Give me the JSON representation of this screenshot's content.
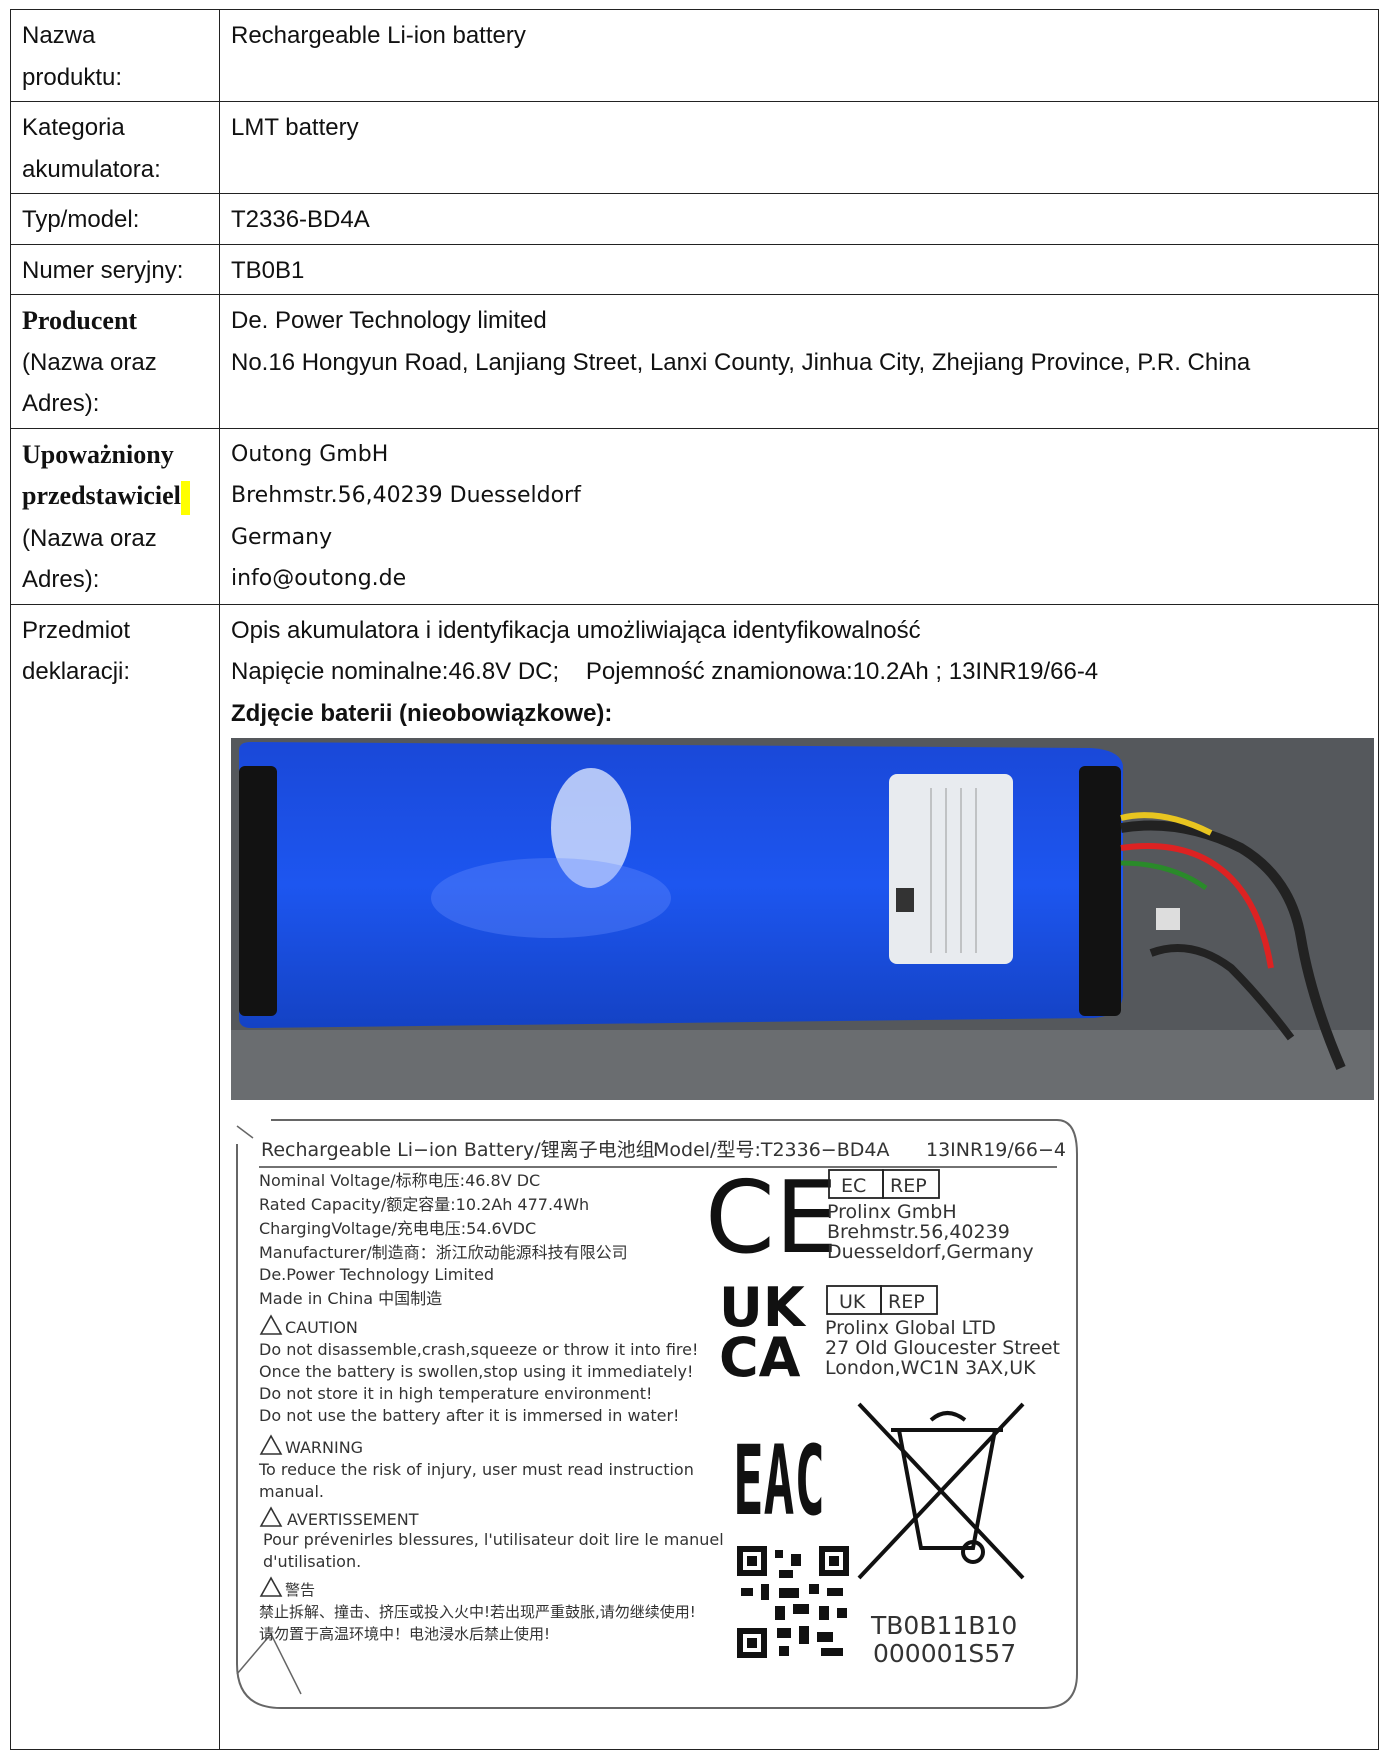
{
  "rows": {
    "product_name": {
      "label_line1": "Nazwa",
      "label_line2": "produktu:",
      "value": "Rechargeable Li-ion battery"
    },
    "category": {
      "label_line1": "Kategoria",
      "label_line2": "akumulatora:",
      "value": "LMT battery"
    },
    "type_model": {
      "label": "Typ/model:",
      "value": "T2336-BD4A"
    },
    "serial": {
      "label": "Numer seryjny:",
      "value": "TB0B1"
    },
    "producer": {
      "label_line1": "Producent",
      "label_line2": "(Nazwa oraz",
      "label_line3": "Adres):",
      "name": "De. Power Technology limited",
      "address": "No.16 Hongyun Road, Lanjiang Street, Lanxi County, Jinhua City, Zhejiang Province, P.R. China"
    },
    "representative": {
      "label_line1": "Upoważniony",
      "label_line2": "przedstawiciel",
      "label_line3": "(Nazwa oraz",
      "label_line4": "Adres):",
      "name": "Outong GmbH",
      "street": "Brehmstr.56,40239 Duesseldorf",
      "country": "Germany",
      "email": "info@outong.de"
    },
    "subject": {
      "label_line1": "Przedmiot",
      "label_line2": "deklaracji:",
      "line1": "Opis akumulatora i identyfikacja umożliwiająca identyfikowalność",
      "line2": "Napięcie nominalne:46.8V DC;    Pojemność znamionowa:10.2Ah ; 13INR19/66-4",
      "photo_caption": "Zdjęcie baterii (nieobowiązkowe):"
    }
  },
  "battery_label": {
    "title": "Rechargeable Li−ion Battery/锂离子电池组",
    "model": "Model/型号:T2336−BD4A",
    "cells": "13INR19/66−4",
    "lines": [
      "Nominal Voltage/标称电压:46.8V DC",
      "Rated Capacity/额定容量:10.2Ah 477.4Wh",
      "ChargingVoltage/充电电压:54.6VDC",
      "Manufacturer/制造商：浙江欣动能源科技有限公司",
      "De.Power Technology Limited",
      "Made in China 中国制造"
    ],
    "caution_title": "CAUTION",
    "caution_lines": [
      "Do not disassemble,crash,squeeze or throw it into fire!",
      "Once the battery is swollen,stop using it immediately!",
      "Do not store it in high temperature environment!",
      "Do not use the battery after it is immersed in water!"
    ],
    "warning_title": "WARNING",
    "warning_lines": [
      "To reduce the risk of injury, user must read instruction",
      "manual."
    ],
    "avert_title": "AVERTISSEMENT",
    "avert_lines": [
      "Pour prévenirles blessures, l'utilisateur doit lire le manuel",
      "d'utilisation."
    ],
    "cn_title": "警告",
    "cn_lines": [
      "禁止拆解、撞击、挤压或投入火中!若出现严重鼓胀,请勿继续使用!",
      "请勿置于高温环境中！电池浸水后禁止使用!"
    ],
    "ce_mark": "CE",
    "ec_rep": [
      "EC",
      "REP"
    ],
    "ec_rep_lines": [
      "Prolinx GmbH",
      "Brehmstr.56,40239",
      "Duesseldorf,Germany"
    ],
    "ukca_mark": [
      "UK",
      "CA"
    ],
    "uk_rep": [
      "UK",
      "REP"
    ],
    "uk_rep_lines": [
      "Prolinx Global LTD",
      "27 Old Gloucester Street",
      "London,WC1N 3AX,UK"
    ],
    "eac_mark": "EAC",
    "serial_lines": [
      "TB0B11B10",
      "000001S57"
    ]
  }
}
